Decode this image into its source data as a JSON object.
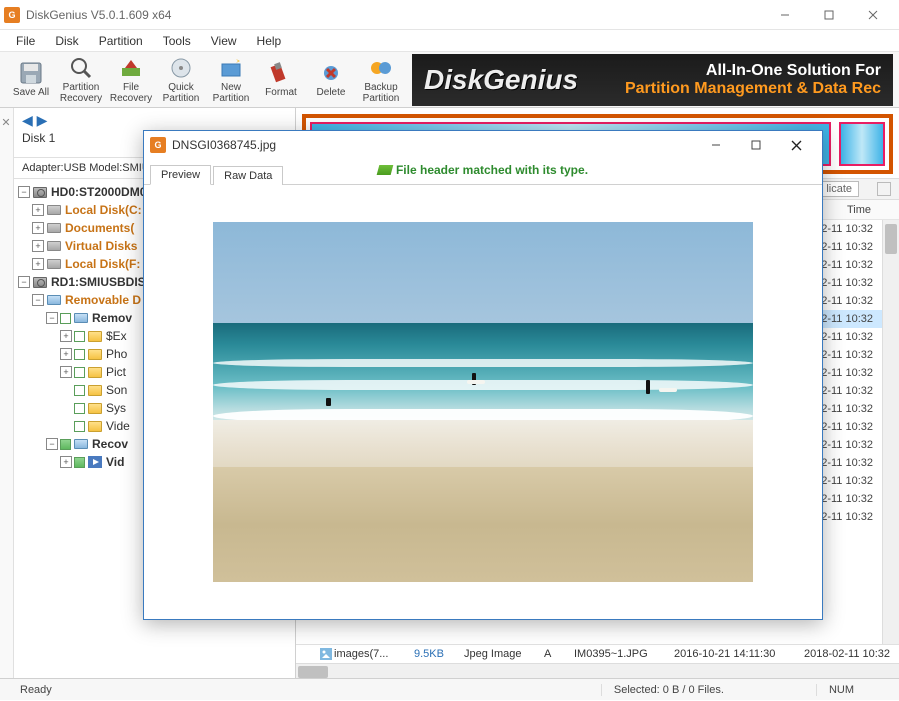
{
  "window": {
    "title": "DiskGenius V5.0.1.609 x64",
    "app_icon_text": "G"
  },
  "menu": {
    "file": "File",
    "disk": "Disk",
    "partition": "Partition",
    "tools": "Tools",
    "view": "View",
    "help": "Help"
  },
  "toolbar": {
    "save_all": "Save All",
    "partition_recovery": "Partition\nRecovery",
    "file_recovery": "File\nRecovery",
    "quick_partition": "Quick\nPartition",
    "new_partition": "New\nPartition",
    "format": "Format",
    "delete": "Delete",
    "backup_partition": "Backup\nPartition"
  },
  "banner": {
    "brand": "DiskGenius",
    "tag1": "All-In-One Solution For",
    "tag2": "Partition Management & Data Rec"
  },
  "disk_nav": {
    "disk_label": "Disk  1"
  },
  "adapter": {
    "text": "Adapter:USB  Model:SMIU"
  },
  "tree": {
    "hd0": "HD0:ST2000DM0",
    "local_c": "Local Disk(C:",
    "documents": "Documents(",
    "virtual_disks": "Virtual Disks",
    "local_f": "Local Disk(F:",
    "rd1": "RD1:SMIUSBDIS",
    "removable_d": "Removable D",
    "removable": "Remov",
    "sex": "$Ex",
    "pho": "Pho",
    "pict": "Pict",
    "son": "Son",
    "sys": "Sys",
    "vide": "Vide",
    "recov": "Recov",
    "vid_bold": "Vid"
  },
  "right": {
    "licate_btn": "licate",
    "time_header": "Time",
    "time_value": "2-11 10:32",
    "row_count": 17,
    "selected_row": 11
  },
  "file_row": {
    "name": "images(7...",
    "size": "9.5KB",
    "type": "Jpeg Image",
    "attr": "A",
    "short": "IM0395~1.JPG",
    "created": "2016-10-21 14:11:30",
    "modified": "2018-02-11 10:32"
  },
  "status": {
    "ready": "Ready",
    "selected": "Selected: 0 B / 0 Files.",
    "num": "NUM"
  },
  "preview": {
    "filename": "DNSGI0368745.jpg",
    "tab_preview": "Preview",
    "tab_raw": "Raw Data",
    "status_text": "File header matched with its type."
  }
}
